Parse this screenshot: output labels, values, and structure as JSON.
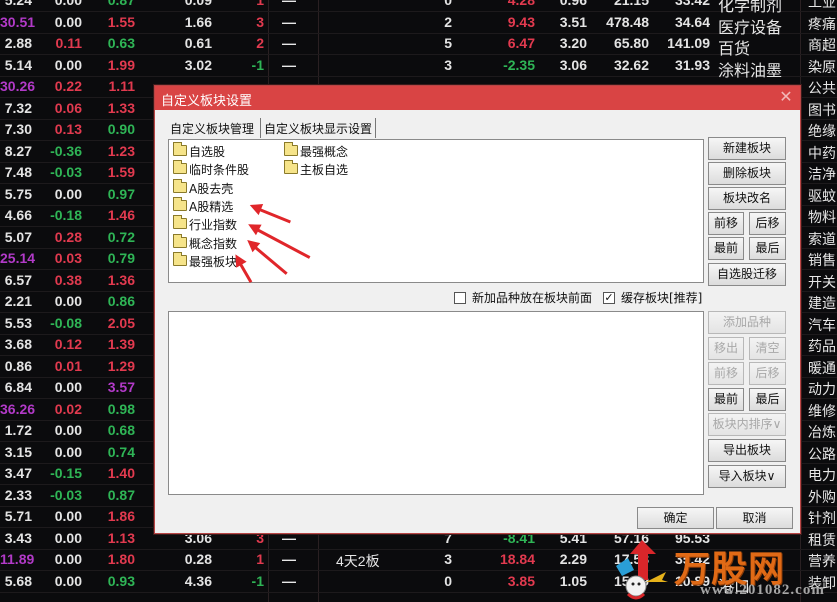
{
  "background_table": {
    "rows": [
      {
        "price": "5.24",
        "price_color": "white",
        "chg": "0.00",
        "chg_color": "white",
        "turn": "0.87",
        "turn_color": "green",
        "vr": "0.09",
        "lim": "1",
        "lim_color": "red",
        "dash": "—",
        "note": "",
        "cnt": "0",
        "pct": "4.28",
        "pct_color": "red",
        "a": "0.96",
        "b": "21.15",
        "c": "33.42",
        "ind": "化学制剂",
        "sub": "工业"
      },
      {
        "price": "30.51",
        "price_color": "purple",
        "chg": "0.00",
        "chg_color": "white",
        "turn": "1.55",
        "turn_color": "red",
        "vr": "1.66",
        "lim": "3",
        "lim_color": "red",
        "dash": "—",
        "note": "",
        "cnt": "2",
        "pct": "9.43",
        "pct_color": "red",
        "a": "3.51",
        "b": "478.48",
        "c": "34.64",
        "ind": "医疗设备",
        "sub": "疼痛"
      },
      {
        "price": "2.88",
        "price_color": "white",
        "chg": "0.11",
        "chg_color": "red",
        "turn": "0.63",
        "turn_color": "green",
        "vr": "0.61",
        "lim": "2",
        "lim_color": "red",
        "dash": "—",
        "note": "",
        "cnt": "5",
        "pct": "6.47",
        "pct_color": "red",
        "a": "3.20",
        "b": "65.80",
        "c": "141.09",
        "ind": "百货",
        "sub": "商超"
      },
      {
        "price": "5.14",
        "price_color": "white",
        "chg": "0.00",
        "chg_color": "white",
        "turn": "1.99",
        "turn_color": "red",
        "vr": "3.02",
        "lim": "-1",
        "lim_color": "green",
        "dash": "—",
        "note": "",
        "cnt": "3",
        "pct": "-2.35",
        "pct_color": "green",
        "a": "3.06",
        "b": "32.62",
        "c": "31.93",
        "ind": "涂料油墨",
        "sub": "染原"
      },
      {
        "price": "30.26",
        "price_color": "purple",
        "chg": "0.22",
        "chg_color": "red",
        "turn": "1.11",
        "turn_color": "red",
        "vr": "",
        "lim": "",
        "lim_color": "red",
        "dash": "",
        "note": "",
        "cnt": "",
        "pct": "",
        "pct_color": "red",
        "a": "",
        "b": "",
        "c": "",
        "ind": "",
        "sub": "公共"
      },
      {
        "price": "7.32",
        "price_color": "white",
        "chg": "0.06",
        "chg_color": "red",
        "turn": "1.33",
        "turn_color": "red",
        "sub": "图书"
      },
      {
        "price": "7.30",
        "price_color": "white",
        "chg": "0.13",
        "chg_color": "red",
        "turn": "0.90",
        "turn_color": "green",
        "sub": "绝缘"
      },
      {
        "price": "8.27",
        "price_color": "white",
        "chg": "-0.36",
        "chg_color": "green",
        "turn": "1.23",
        "turn_color": "red",
        "sub": "中药"
      },
      {
        "price": "7.48",
        "price_color": "white",
        "chg": "-0.03",
        "chg_color": "green",
        "turn": "1.59",
        "turn_color": "red",
        "sub": "洁净"
      },
      {
        "price": "5.75",
        "price_color": "white",
        "chg": "0.00",
        "chg_color": "white",
        "turn": "0.97",
        "turn_color": "green",
        "sub": "驱蚊"
      },
      {
        "price": "4.66",
        "price_color": "white",
        "chg": "-0.18",
        "chg_color": "green",
        "turn": "1.46",
        "turn_color": "red",
        "sub": "物料"
      },
      {
        "price": "5.07",
        "price_color": "white",
        "chg": "0.28",
        "chg_color": "red",
        "turn": "0.72",
        "turn_color": "green",
        "sub": "索道"
      },
      {
        "price": "25.14",
        "price_color": "purple",
        "chg": "0.03",
        "chg_color": "red",
        "turn": "0.79",
        "turn_color": "green",
        "sub": "销售"
      },
      {
        "price": "6.57",
        "price_color": "white",
        "chg": "0.38",
        "chg_color": "red",
        "turn": "1.36",
        "turn_color": "red",
        "sub": "开关"
      },
      {
        "price": "2.21",
        "price_color": "white",
        "chg": "0.00",
        "chg_color": "white",
        "turn": "0.86",
        "turn_color": "green",
        "sub": "建造"
      },
      {
        "price": "5.53",
        "price_color": "white",
        "chg": "-0.08",
        "chg_color": "green",
        "turn": "2.05",
        "turn_color": "red",
        "sub": "汽车"
      },
      {
        "price": "3.68",
        "price_color": "white",
        "chg": "0.12",
        "chg_color": "red",
        "turn": "1.39",
        "turn_color": "red",
        "sub": "药品"
      },
      {
        "price": "0.86",
        "price_color": "white",
        "chg": "0.01",
        "chg_color": "red",
        "turn": "1.29",
        "turn_color": "red",
        "sub": "暖通"
      },
      {
        "price": "6.84",
        "price_color": "white",
        "chg": "0.00",
        "chg_color": "white",
        "turn": "3.57",
        "turn_color": "purple",
        "sub": "动力"
      },
      {
        "price": "36.26",
        "price_color": "purple",
        "chg": "0.02",
        "chg_color": "red",
        "turn": "0.98",
        "turn_color": "green",
        "sub": "维修"
      },
      {
        "price": "1.72",
        "price_color": "white",
        "chg": "0.00",
        "chg_color": "white",
        "turn": "0.68",
        "turn_color": "green",
        "sub": "冶炼"
      },
      {
        "price": "3.15",
        "price_color": "white",
        "chg": "0.00",
        "chg_color": "white",
        "turn": "0.74",
        "turn_color": "green",
        "sub": "公路"
      },
      {
        "price": "3.47",
        "price_color": "white",
        "chg": "-0.15",
        "chg_color": "green",
        "turn": "1.40",
        "turn_color": "red",
        "sub": "电力"
      },
      {
        "price": "2.33",
        "price_color": "white",
        "chg": "-0.03",
        "chg_color": "green",
        "turn": "0.87",
        "turn_color": "green",
        "sub": "外购"
      },
      {
        "price": "5.71",
        "price_color": "white",
        "chg": "0.00",
        "chg_color": "white",
        "turn": "1.86",
        "turn_color": "red",
        "sub": "针剂"
      },
      {
        "price": "3.43",
        "price_color": "white",
        "chg": "0.00",
        "chg_color": "white",
        "turn": "1.13",
        "turn_color": "red",
        "vr": "3.06",
        "lim": "3",
        "lim_color": "red",
        "dash": "—",
        "note": "",
        "cnt": "7",
        "pct": "-8.41",
        "pct_color": "green",
        "a": "5.41",
        "b": "57.16",
        "c": "95.53",
        "ind": "",
        "sub": "租赁"
      },
      {
        "price": "11.89",
        "price_color": "purple",
        "chg": "0.00",
        "chg_color": "white",
        "turn": "1.80",
        "turn_color": "red",
        "vr": "0.28",
        "lim": "1",
        "lim_color": "red",
        "dash": "—",
        "note": "4天2板",
        "cnt": "3",
        "pct": "18.84",
        "pct_color": "red",
        "a": "2.29",
        "b": "17.58",
        "c": "35.42",
        "ind": "",
        "sub": "营养"
      },
      {
        "price": "5.68",
        "price_color": "white",
        "chg": "0.00",
        "chg_color": "white",
        "turn": "0.93",
        "turn_color": "green",
        "vr": "4.36",
        "lim": "-1",
        "lim_color": "green",
        "dash": "—",
        "note": "",
        "cnt": "0",
        "pct": "3.85",
        "pct_color": "red",
        "a": "1.05",
        "b": "15.09",
        "c": "10.89",
        "ind": "港口",
        "sub": "装卸"
      }
    ]
  },
  "dialog": {
    "title": "自定义板块设置",
    "close_glyph": "✕",
    "tabs": [
      {
        "label": "自定义板块管理",
        "active": true
      },
      {
        "label": "自定义板块显示设置",
        "active": false
      }
    ],
    "folders": [
      {
        "label": "自选股"
      },
      {
        "label": "临时条件股"
      },
      {
        "label": "A股去壳"
      },
      {
        "label": "A股精选"
      },
      {
        "label": "行业指数"
      },
      {
        "label": "概念指数"
      },
      {
        "label": "最强板块"
      },
      {
        "label": "最强概念"
      },
      {
        "label": "主板自选"
      }
    ],
    "options": {
      "add_front": {
        "label": "新加品种放在板块前面",
        "checked": false,
        "mark": ""
      },
      "cache_block": {
        "label": "缓存板块[推荐]",
        "checked": true,
        "mark": "✓"
      }
    },
    "block_buttons": {
      "new": "新建板块",
      "delete": "删除板块",
      "rename": "板块改名",
      "move_up": "前移",
      "move_down": "后移",
      "to_first": "最前",
      "to_last": "最后",
      "migrate": "自选股迁移"
    },
    "item_buttons": {
      "add": "添加品种",
      "remove": "移出",
      "clear": "清空",
      "move_up": "前移",
      "move_down": "后移",
      "to_first": "最前",
      "to_last": "最后",
      "sort": "板块内排序∨",
      "export": "导出板块",
      "import": "导入板块∨"
    },
    "footer": {
      "ok": "确定",
      "cancel": "取消"
    }
  },
  "watermark": {
    "brand": "万股网",
    "url": "www.201082.com",
    "brand_color": "#e06a16"
  }
}
